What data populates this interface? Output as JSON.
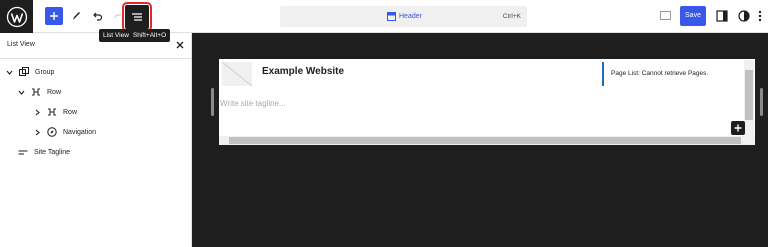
{
  "toolbar": {
    "app_logo": "wordpress-logo",
    "add_block_icon": "plus-icon",
    "tools_icon": "pencil-icon",
    "undo_icon": "undo-icon",
    "redo_icon": "redo-icon",
    "list_view_icon": "list-view-icon",
    "document_bar": {
      "icon": "template-part-icon",
      "title": "Header",
      "shortcut": "Ctrl+K"
    },
    "device_preview_icon": "desktop-icon",
    "save_label": "Save",
    "settings_icon": "sidebar-icon",
    "styles_icon": "half-circle-icon",
    "options_icon": "vertical-ellipsis-icon"
  },
  "tooltip": {
    "label": "List View",
    "shortcut": "Shift+Alt+O"
  },
  "sidebar": {
    "title": "List View",
    "close_icon": "close-icon",
    "items": [
      {
        "label": "Group",
        "icon": "group-icon",
        "expanded": true,
        "level": 1
      },
      {
        "label": "Row",
        "icon": "row-icon",
        "expanded": true,
        "level": 2
      },
      {
        "label": "Row",
        "icon": "row-icon",
        "expanded": false,
        "level": 3
      },
      {
        "label": "Navigation",
        "icon": "navigation-icon",
        "expanded": false,
        "level": 3
      },
      {
        "label": "Site Tagline",
        "icon": "tagline-icon",
        "expanded": null,
        "level": 2
      }
    ]
  },
  "canvas": {
    "site_title": "Example Website",
    "page_list_message": "Page List: Cannot retrieve Pages.",
    "tagline_placeholder": "Write site tagline...",
    "inserter_icon": "plus-icon"
  },
  "colors": {
    "accent": "#3858e9",
    "dark": "#1e1e1e",
    "highlight_outline": "#e02929"
  }
}
